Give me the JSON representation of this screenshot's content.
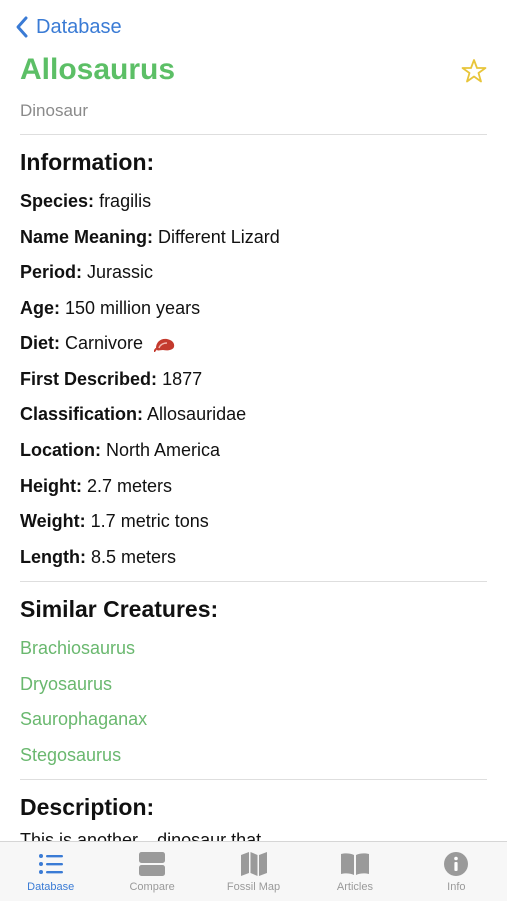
{
  "nav": {
    "back_label": "Database"
  },
  "header": {
    "title": "Allosaurus",
    "subtitle": "Dinosaur"
  },
  "information": {
    "heading": "Information:",
    "rows": [
      {
        "label": "Species:",
        "value": "fragilis"
      },
      {
        "label": "Name Meaning:",
        "value": "Different Lizard"
      },
      {
        "label": "Period:",
        "value": "Jurassic"
      },
      {
        "label": "Age:",
        "value": "150 million years"
      },
      {
        "label": "Diet:",
        "value": "Carnivore"
      },
      {
        "label": "First Described:",
        "value": "1877"
      },
      {
        "label": "Classification:",
        "value": "Allosauridae"
      },
      {
        "label": "Location:",
        "value": "North America"
      },
      {
        "label": "Height:",
        "value": "2.7 meters"
      },
      {
        "label": "Weight:",
        "value": "1.7 metric tons"
      },
      {
        "label": "Length:",
        "value": "8.5 meters"
      }
    ]
  },
  "similar": {
    "heading": "Similar Creatures:",
    "items": [
      "Brachiosaurus",
      "Dryosaurus",
      "Saurophaganax",
      "Stegosaurus"
    ]
  },
  "description": {
    "heading": "Description:",
    "text_partial": "This is another... dinosaur that..."
  },
  "tabbar": {
    "tabs": [
      {
        "label": "Database",
        "icon": "list-icon",
        "active": true
      },
      {
        "label": "Compare",
        "icon": "compare-icon",
        "active": false
      },
      {
        "label": "Fossil Map",
        "icon": "map-icon",
        "active": false
      },
      {
        "label": "Articles",
        "icon": "book-icon",
        "active": false
      },
      {
        "label": "Info",
        "icon": "info-icon",
        "active": false
      }
    ]
  },
  "colors": {
    "accent_blue": "#3a7bd5",
    "title_green": "#5cbf66",
    "link_green": "#6ab86f",
    "star_yellow": "#e8c53a",
    "inactive_gray": "#9a9a9a"
  }
}
